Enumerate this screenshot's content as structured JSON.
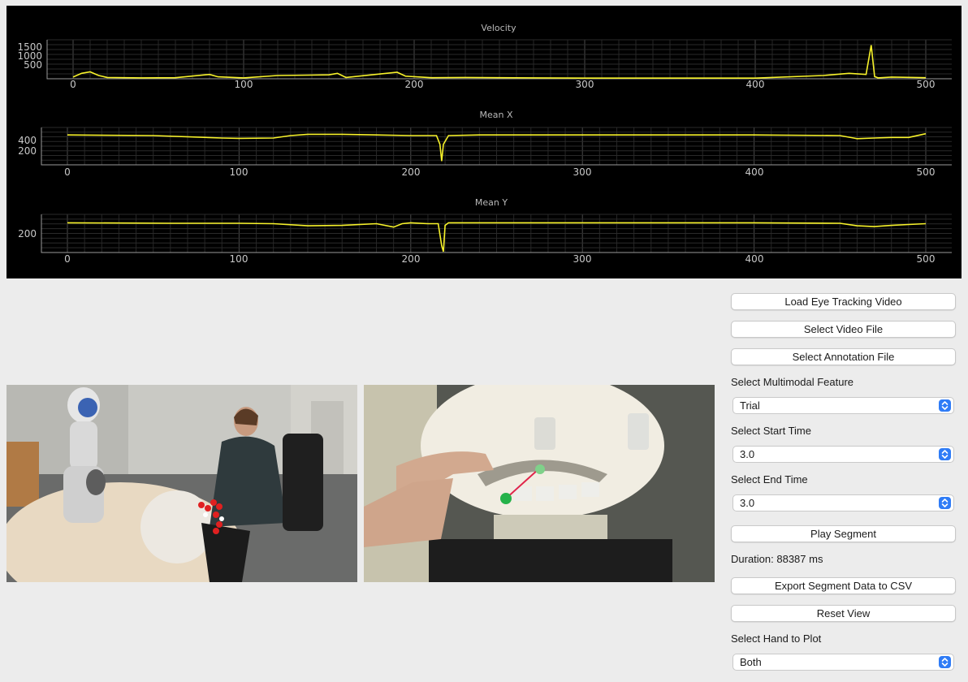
{
  "plots": {
    "velocity": {
      "title": "Velocity",
      "yticks": [
        "1500",
        "1000",
        "500"
      ],
      "xticks": [
        "0",
        "100",
        "200",
        "300",
        "400",
        "500"
      ]
    },
    "mean_x": {
      "title": "Mean X",
      "yticks": [
        "400",
        "200"
      ],
      "xticks": [
        "0",
        "100",
        "200",
        "300",
        "400",
        "500"
      ]
    },
    "mean_y": {
      "title": "Mean Y",
      "yticks": [
        "200"
      ],
      "xticks": [
        "0",
        "100",
        "200",
        "300",
        "400",
        "500"
      ]
    },
    "line_color": "#f7f22a"
  },
  "chart_data": [
    {
      "type": "line",
      "title": "Velocity",
      "xlim": [
        0,
        500
      ],
      "ylim": [
        0,
        1800
      ],
      "x": [
        0,
        5,
        10,
        15,
        20,
        40,
        60,
        80,
        85,
        100,
        120,
        150,
        155,
        160,
        190,
        195,
        210,
        230,
        270,
        300,
        350,
        400,
        440,
        455,
        465,
        468,
        470,
        472,
        480,
        500
      ],
      "values": [
        80,
        250,
        320,
        150,
        60,
        40,
        50,
        200,
        90,
        40,
        150,
        180,
        250,
        60,
        300,
        120,
        50,
        60,
        40,
        30,
        30,
        30,
        150,
        250,
        200,
        1550,
        100,
        40,
        80,
        50
      ]
    },
    {
      "type": "line",
      "title": "Mean X",
      "xlim": [
        0,
        500
      ],
      "ylim": [
        0,
        600
      ],
      "x": [
        0,
        50,
        90,
        100,
        120,
        130,
        140,
        160,
        180,
        200,
        215,
        217,
        218,
        219,
        222,
        240,
        300,
        400,
        450,
        458,
        460,
        470,
        480,
        490,
        500
      ],
      "values": [
        480,
        470,
        430,
        425,
        430,
        470,
        490,
        490,
        480,
        470,
        470,
        330,
        60,
        330,
        470,
        480,
        480,
        480,
        470,
        430,
        420,
        430,
        440,
        440,
        500
      ]
    },
    {
      "type": "line",
      "title": "Mean Y",
      "xlim": [
        0,
        500
      ],
      "ylim": [
        0,
        450
      ],
      "x": [
        0,
        60,
        100,
        120,
        140,
        160,
        180,
        190,
        195,
        200,
        210,
        216,
        218,
        219,
        220,
        222,
        240,
        300,
        400,
        450,
        460,
        470,
        480,
        490,
        500
      ],
      "values": [
        350,
        345,
        345,
        340,
        315,
        320,
        340,
        300,
        340,
        350,
        340,
        340,
        80,
        10,
        320,
        350,
        350,
        350,
        350,
        345,
        315,
        305,
        320,
        330,
        340
      ]
    }
  ],
  "controls": {
    "load_eye_label": "Load Eye Tracking Video",
    "select_video_label": "Select Video File",
    "select_annotation_label": "Select Annotation File",
    "feature_label": "Select Multimodal Feature",
    "feature_value": "Trial",
    "start_label": "Select Start Time",
    "start_value": "3.0",
    "end_label": "Select End Time",
    "end_value": "3.0",
    "play_label": "Play Segment",
    "duration_text": "Duration: 88387 ms",
    "export_label": "Export Segment Data to CSV",
    "reset_label": "Reset View",
    "hand_label": "Select Hand to Plot",
    "hand_value": "Both"
  },
  "videos": {
    "left_video": "external-camera-video",
    "right_video": "eye-tracking-video"
  }
}
